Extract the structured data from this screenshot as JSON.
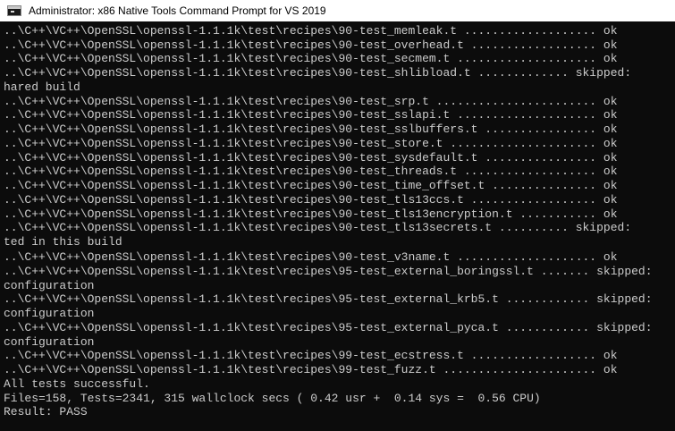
{
  "window": {
    "title": "Administrator: x86 Native Tools Command Prompt for VS 2019",
    "icon": "terminal-icon"
  },
  "console": {
    "lines": [
      "..\\C++\\VC++\\OpenSSL\\openssl-1.1.1k\\test\\recipes\\90-test_memleak.t ................... ok",
      "..\\C++\\VC++\\OpenSSL\\openssl-1.1.1k\\test\\recipes\\90-test_overhead.t .................. ok",
      "..\\C++\\VC++\\OpenSSL\\openssl-1.1.1k\\test\\recipes\\90-test_secmem.t .................... ok",
      "..\\C++\\VC++\\OpenSSL\\openssl-1.1.1k\\test\\recipes\\90-test_shlibload.t ............. skipped:",
      "hared build",
      "..\\C++\\VC++\\OpenSSL\\openssl-1.1.1k\\test\\recipes\\90-test_srp.t ....................... ok",
      "..\\C++\\VC++\\OpenSSL\\openssl-1.1.1k\\test\\recipes\\90-test_sslapi.t .................... ok",
      "..\\C++\\VC++\\OpenSSL\\openssl-1.1.1k\\test\\recipes\\90-test_sslbuffers.t ................ ok",
      "..\\C++\\VC++\\OpenSSL\\openssl-1.1.1k\\test\\recipes\\90-test_store.t ..................... ok",
      "..\\C++\\VC++\\OpenSSL\\openssl-1.1.1k\\test\\recipes\\90-test_sysdefault.t ................ ok",
      "..\\C++\\VC++\\OpenSSL\\openssl-1.1.1k\\test\\recipes\\90-test_threads.t ................... ok",
      "..\\C++\\VC++\\OpenSSL\\openssl-1.1.1k\\test\\recipes\\90-test_time_offset.t ............... ok",
      "..\\C++\\VC++\\OpenSSL\\openssl-1.1.1k\\test\\recipes\\90-test_tls13ccs.t .................. ok",
      "..\\C++\\VC++\\OpenSSL\\openssl-1.1.1k\\test\\recipes\\90-test_tls13encryption.t ........... ok",
      "..\\C++\\VC++\\OpenSSL\\openssl-1.1.1k\\test\\recipes\\90-test_tls13secrets.t .......... skipped:",
      "ted in this build",
      "..\\C++\\VC++\\OpenSSL\\openssl-1.1.1k\\test\\recipes\\90-test_v3name.t .................... ok",
      "..\\C++\\VC++\\OpenSSL\\openssl-1.1.1k\\test\\recipes\\95-test_external_boringssl.t ....... skipped:",
      "configuration",
      "..\\C++\\VC++\\OpenSSL\\openssl-1.1.1k\\test\\recipes\\95-test_external_krb5.t ............ skipped:",
      "configuration",
      "..\\C++\\VC++\\OpenSSL\\openssl-1.1.1k\\test\\recipes\\95-test_external_pyca.t ............ skipped:",
      "configuration",
      "..\\C++\\VC++\\OpenSSL\\openssl-1.1.1k\\test\\recipes\\99-test_ecstress.t .................. ok",
      "..\\C++\\VC++\\OpenSSL\\openssl-1.1.1k\\test\\recipes\\99-test_fuzz.t ...................... ok",
      "All tests successful.",
      "Files=158, Tests=2341, 315 wallclock secs ( 0.42 usr +  0.14 sys =  0.56 CPU)",
      "Result: PASS"
    ]
  }
}
